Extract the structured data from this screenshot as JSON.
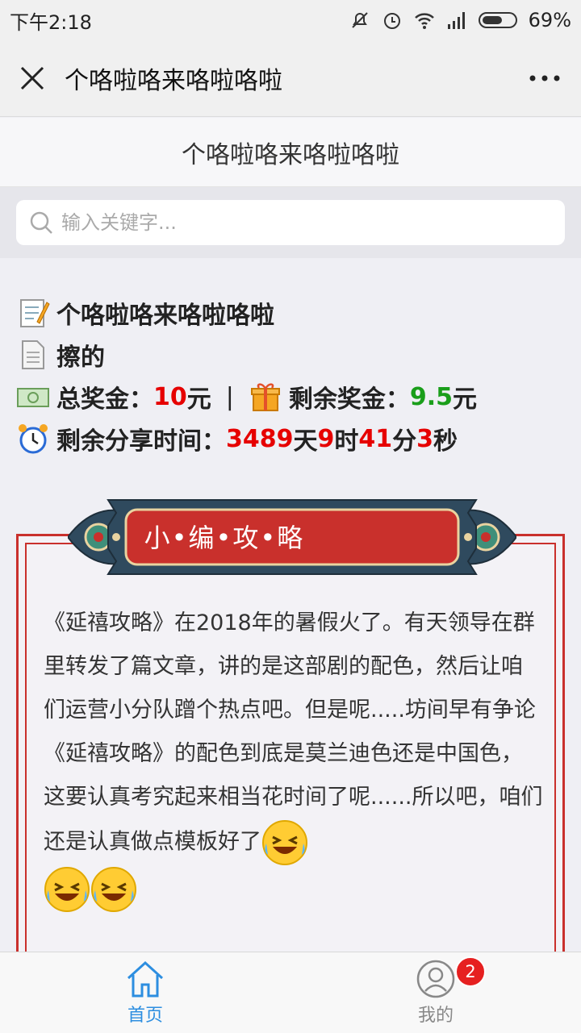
{
  "status_bar": {
    "time": "下午2:18",
    "battery": "69%"
  },
  "title_bar": {
    "title": "个咯啦咯来咯啦咯啦"
  },
  "page_header": {
    "title": "个咯啦咯来咯啦咯啦"
  },
  "search": {
    "placeholder": "输入关键字..."
  },
  "info": {
    "title": "个咯啦咯来咯啦咯啦",
    "subtitle": "擦的",
    "total_label": "总奖金：",
    "total_value": "10",
    "total_unit": "元",
    "separator": "|",
    "remain_label": "剩余奖金：",
    "remain_value": "9.5",
    "remain_unit": "元",
    "time_label": "剩余分享时间：",
    "days": "3489",
    "days_unit": "天",
    "hours": "9",
    "hours_unit": "时",
    "minutes": "41",
    "minutes_unit": "分",
    "seconds": "3",
    "seconds_unit": "秒"
  },
  "card": {
    "banner": "小•编•攻•略",
    "article": "《延禧攻略》在2018年的暑假火了。有天领导在群里转发了篇文章，讲的是这部剧的配色，然后让咱们运营小分队蹭个热点吧。但是呢.....坊间早有争论《延禧攻略》的配色到底是莫兰迪色还是中国色，这要认真考究起来相当花时间了呢......所以吧，咱们还是认真做点模板好了"
  },
  "tabbar": {
    "home_label": "首页",
    "mine_label": "我的",
    "mine_badge": "2"
  },
  "colors": {
    "accent": "#2d8ee0",
    "red": "#e60000",
    "green": "#1a9e1a",
    "banner": "#c9302c"
  }
}
